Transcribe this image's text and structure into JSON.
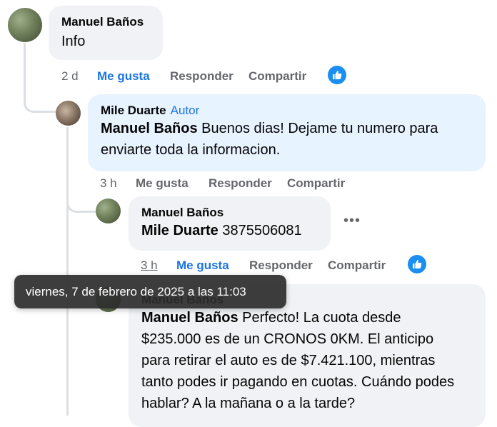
{
  "comments": [
    {
      "author": "Manuel Baños",
      "text": "Info",
      "time": "2 d",
      "like_label": "Me gusta",
      "reply_label": "Responder",
      "share_label": "Compartir"
    },
    {
      "author": "Mile Duarte",
      "author_badge": "Autor",
      "mention": "Manuel Baños",
      "text": " Buenos dias! Dejame tu numero para enviarte toda la informacion.",
      "time": "3 h",
      "like_label": "Me gusta",
      "reply_label": "Responder",
      "share_label": "Compartir"
    },
    {
      "author": "Manuel Baños",
      "mention": "Mile Duarte",
      "text": " 3875506081",
      "more": "•••",
      "time": "3 h",
      "like_label": "Me gusta",
      "reply_label": "Responder",
      "share_label": "Compartir"
    },
    {
      "author": "Manuel Baños",
      "mention": "Manuel Baños",
      "text": " Perfecto! La cuota desde $235.000 es de un CRONOS 0KM. El anticipo para retirar el auto es de $7.421.100, mientras tanto podes ir pagando en cuotas. Cuándo podes hablar? A la mañana o a la tarde?"
    }
  ],
  "tooltip": "viernes, 7 de febrero de 2025 a las 11:03",
  "colors": {
    "link_blue": "#1b74e4",
    "bubble_grey": "#f0f2f5",
    "bubble_highlight": "#e7f3ff"
  }
}
